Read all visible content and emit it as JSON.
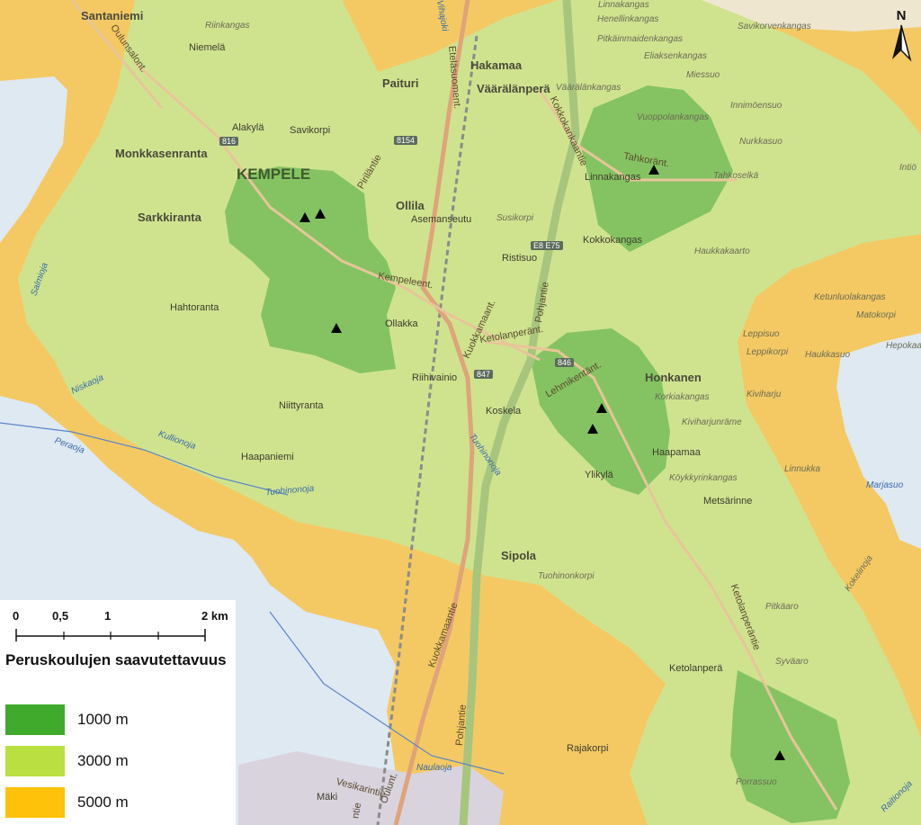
{
  "map": {
    "colors": {
      "zone_1000": "#5fa84a",
      "zone_3000": "#c8e08a",
      "zone_5000": "#f2c55e",
      "water": "#dfe9f2",
      "outside": "#efe4c8",
      "school": "#000000"
    },
    "school_icon": "triangle-marker-icon",
    "north_icon": "north-arrow-icon",
    "north_label": "N",
    "places": {
      "santaniemi": "Santaniemi",
      "riinkangas": "Riinkangas",
      "niemela": "Niemelä",
      "paituri": "Paituri",
      "hakamaa": "Hakamaa",
      "vaaralanpera": "Väärälänperä",
      "alakyla": "Alakylä",
      "savikorpi": "Savikorpi",
      "monkkasenranta": "Monkkasenranta",
      "kempele": "KEMPELE",
      "sarkkiranta": "Sarkkiranta",
      "ollila": "Ollila",
      "asemanseutu": "Asemanseutu",
      "ristisuo": "Ristisuo",
      "kokkokangas": "Kokkokangas",
      "linnakangas": "Linnakangas",
      "hahtoranta": "Hahtoranta",
      "ollakka": "Ollakka",
      "riihivainio": "Riihivainio",
      "koskela": "Koskela",
      "honkanen": "Honkanen",
      "niittyranta": "Niittyranta",
      "haapaniemi": "Haapaniemi",
      "haapamaa": "Haapamaa",
      "ylikyla": "Ylikylä",
      "metsarinne": "Metsärinne",
      "sipola": "Sipola",
      "ketolanpera": "Ketolanperä",
      "rajakorpi": "Rajakorpi",
      "maki": "Mäki"
    },
    "minor_places": {
      "linnakangas_n": "Linnakangas",
      "henellinkangas": "Henellinkangas",
      "pitkainmaidenkangas": "Pitkäinmaidenkangas",
      "eliaksenkangas": "Eliaksenkangas",
      "miessuo": "Miessuo",
      "savikorvenkangas": "Savikorvenkangas",
      "vaaralankangas": "Väärälänkangas",
      "innimoensuo": "Innimöensuo",
      "vuoppolankangas": "Vuoppolankangas",
      "nurkkasuo": "Nurkkasuo",
      "tahkoselka": "Tahkoselkä",
      "intio": "Intiö",
      "susikorpi": "Susikorpi",
      "haukkakaarto": "Haukkakaarto",
      "ketunluolakangas": "Ketunluolakangas",
      "matokorpi": "Matokorpi",
      "leppisuo": "Leppisuo",
      "leppikorpi": "Leppikorpi",
      "haukkasuo": "Haukkasuo",
      "hepokaarto": "Hepokaa",
      "korkiakangas": "Korkiakangas",
      "kiviharju": "Kiviharju",
      "kiviharjunrame": "Kiviharjunräme",
      "linnukka": "Linnukka",
      "marjasuo": "Marjasuo",
      "koykkyrinkangas": "Köykkyrinkangas",
      "tuohinonkorpi": "Tuohinonkorpi",
      "kokelinoja": "Kokelinoja",
      "pitkaaro": "Pitkäaro",
      "syvaaro": "Syväaro",
      "porrassuo": "Porrassuo",
      "raitionoja": "Raitionoja"
    },
    "roads": {
      "oulunsalontie": "Oulunsalont.",
      "etelasuoment": "Eteläsuoment.",
      "kokkokankaantie": "Kokkokankaantie",
      "tahkoraitti": "Tahkoränt.",
      "pirilantie": "Piriläntie",
      "kempeleent": "Kempeleent.",
      "kuokkamaant": "Kuokkamaant.",
      "ketolanperant": "Ketolanperänt.",
      "lehmikentant": "Lehmikentänt.",
      "pohjantie": "Pohjantie",
      "kuokkamaantie": "Kuokkamaantie",
      "pohjantie_s": "Pohjantie",
      "oulunt": "Oulunt.",
      "vesikarintie": "Vesikarintie",
      "ketolanperantie": "Ketolanperäntie",
      "kallionoja": "Kullionoja",
      "tuohinonoja": "Tuohinonoja",
      "tuohinonoja2": "Tuohinonoja",
      "peraoja": "Peraoja",
      "niskaoja": "Niskaoja",
      "salmioja": "Salmioja",
      "vihanjoki": "Vihajoki",
      "naulaoja": "Naulaoja",
      "kantie": "ntie"
    },
    "road_numbers": {
      "r816": "816",
      "r8154": "8154",
      "r847": "847",
      "r846": "846",
      "e8e75": "E8 E75"
    }
  },
  "legend": {
    "scale_ticks": [
      "0",
      "0,5",
      "1",
      "2 km"
    ],
    "title": "Peruskoulujen saavutettavuus",
    "items": [
      {
        "label": "1000 m",
        "color": "#3faa2c"
      },
      {
        "label": "3000 m",
        "color": "#b9e040"
      },
      {
        "label": "5000 m",
        "color": "#fec20a"
      }
    ]
  }
}
